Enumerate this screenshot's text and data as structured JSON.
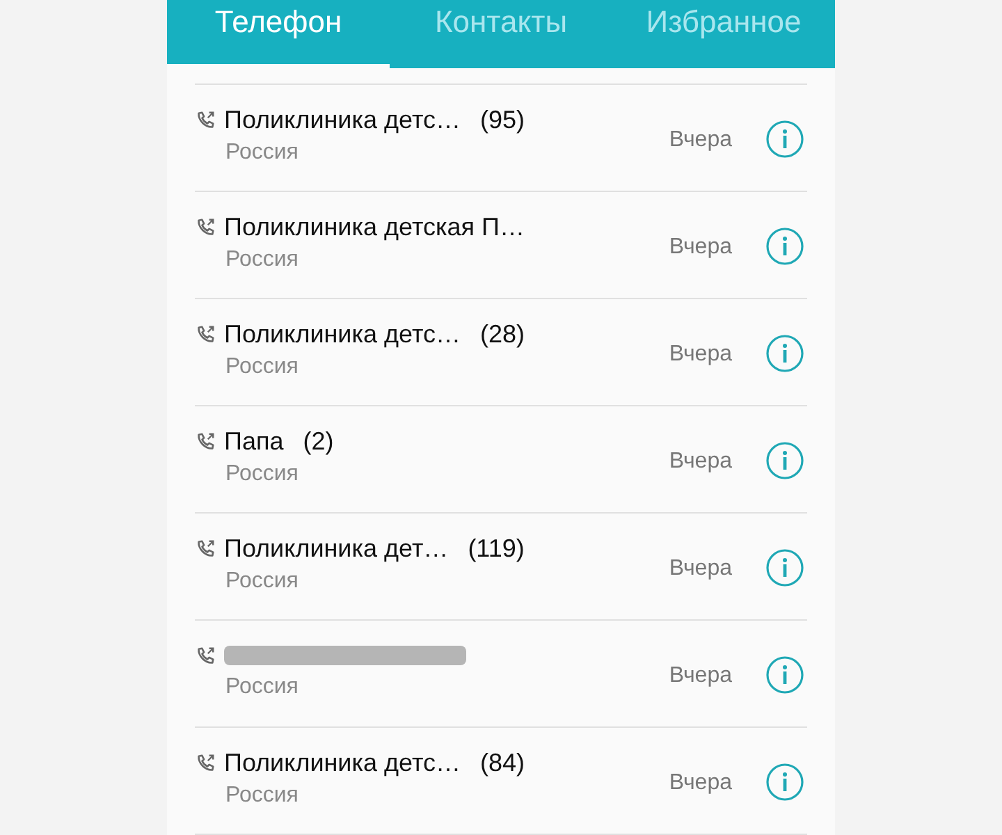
{
  "tabs": [
    {
      "label": "Телефон",
      "selected": true
    },
    {
      "label": "Контакты",
      "selected": false
    },
    {
      "label": "Избранное",
      "selected": false
    }
  ],
  "calls": [
    {
      "name": "Поликлиника детс…",
      "count": "(95)",
      "location": "Россия",
      "time": "Вчера",
      "blurred": false
    },
    {
      "name": "Поликлиника детская П…",
      "location": "Россия",
      "time": "Вчера",
      "blurred": false
    },
    {
      "name": "Поликлиника детс…",
      "count": "(28)",
      "location": "Россия",
      "time": "Вчера",
      "blurred": false
    },
    {
      "name": "Папа",
      "count": "(2)",
      "location": "Россия",
      "time": "Вчера",
      "blurred": false
    },
    {
      "name": "Поликлиника дет…",
      "count": "(119)",
      "location": "Россия",
      "time": "Вчера",
      "blurred": false
    },
    {
      "location": "Россия",
      "time": "Вчера",
      "blurred": true
    },
    {
      "name": "Поликлиника детс…",
      "count": "(84)",
      "location": "Россия",
      "time": "Вчера",
      "blurred": false
    }
  ]
}
